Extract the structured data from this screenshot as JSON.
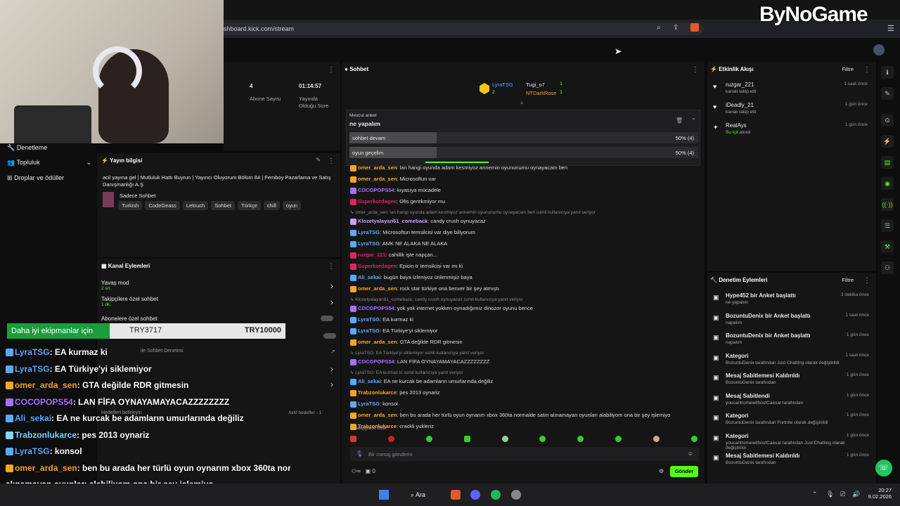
{
  "browser": {
    "url": "shboard.kick.com/stream"
  },
  "watermark": "ByNoGame",
  "left_nav": [
    {
      "label": "Denetleme"
    },
    {
      "label": "Topluluk"
    },
    {
      "label": "Droplar ve ödüller"
    }
  ],
  "stats": {
    "subs_value": "4",
    "subs_label": "Abone Sayısı",
    "time_value": "01:14:57",
    "time_label1": "Yayında",
    "time_label2": "Olduğu Süre"
  },
  "stream_info": {
    "header": "Yayın bilgisi",
    "title": "acil yayına gel | Mutluluk Hattı Buyrun | Yayıncı Oluyorum Bölüm 84 | Femboy Pazarlama ve Satış Danışmanlığı A.Ş",
    "category": "Sadece Sohbet",
    "tags": [
      "Turkish",
      "CodeGeass",
      "Lelouch",
      "Sohbet",
      "Türkçe",
      "chill",
      "oyun"
    ]
  },
  "channel_actions": {
    "header": "Kanal Eylemleri",
    "items": [
      {
        "label": "Yavaş mod",
        "sub": "2 sn."
      },
      {
        "label": "Takipçilere özel sohbet",
        "sub": "1 dk."
      },
      {
        "label": "Abonelere özel sohbet",
        "sub": ""
      }
    ],
    "extra1": "ile Sohbet Denetimi",
    "extra2": "Hedefleri belirleyin",
    "extra3": "Aktif hedefler - 1"
  },
  "chat": {
    "header": "Sohbet",
    "top_users": [
      {
        "name": "LyraTSG",
        "count": "2"
      },
      {
        "name": "Tugi_o7",
        "count": "1"
      },
      {
        "name": "NTDarkRose",
        "count": "1"
      }
    ],
    "poll": {
      "label": "Mevcut anket",
      "question": "ne yapalım",
      "options": [
        {
          "text": "sohbet devam",
          "pct": "50% (4)",
          "fill": 0.5
        },
        {
          "text": "oyun geçelim",
          "pct": "50% (4)",
          "fill": 0.5
        }
      ]
    },
    "lines": [
      {
        "user": "omer_arda_sen",
        "color": "#f5a623",
        "text": ": lan hangi oyunda adam kesmiyoz annemin oyununumu oynayacam ben"
      },
      {
        "user": "omer_arda_sen",
        "color": "#f5a623",
        "text": ": Microsoftun var"
      },
      {
        "user": "COCOPOPS54",
        "color": "#a970ff",
        "text": ": kıyasıya mücadele"
      },
      {
        "user": "Superkordagen",
        "color": "#e0245e",
        "text": ": Ofis gerekmiyor mu"
      },
      {
        "sys": "omer_arda_sen: lan hangi oyunda adam kesmiyoz annemin oyununumu oynayacam ben isimli kullanıcıya yanıt veriyor"
      },
      {
        "user": "Klozetyalayan61_comeback",
        "color": "#c9a0ff",
        "text": ": candy crush oynuyacaz"
      },
      {
        "user": "LyraTSG",
        "color": "#5aa9ff",
        "text": ": Microsoftun temsilcisi var diye biliyorum"
      },
      {
        "user": "LyraTSG",
        "color": "#5aa9ff",
        "text": ": AMK NE ALAKA NE ALAKA"
      },
      {
        "user": "ruzgar_221",
        "color": "#e0245e",
        "text": ": cahillik işte napçan..."
      },
      {
        "user": "Superkordagen",
        "color": "#e0245e",
        "text": ": Epicin tr temsilcisi var mı ki"
      },
      {
        "user": "Ali_sekai",
        "color": "#5aa9ff",
        "text": ": bugün baya izleniyoz ünlenmişiz baya"
      },
      {
        "user": "omer_arda_sen",
        "color": "#f5a623",
        "text": ": rock star türkiye ona benxer bir şey atmıştı"
      },
      {
        "sys": "Klozetyalayan61_comeback: candy crush oynuyacaz isimli kullanıcıya yanıt veriyor"
      },
      {
        "user": "COCOPOPS54",
        "color": "#a970ff",
        "text": ": yok yok internet yokken oynadığımız dinozor oyunu bence"
      },
      {
        "user": "LyraTSG",
        "color": "#5aa9ff",
        "text": ": EA kurmaz ki"
      },
      {
        "user": "LyraTSG",
        "color": "#5aa9ff",
        "text": ": EA Türkiye'yi siklemiyor"
      },
      {
        "user": "omer_arda_sen",
        "color": "#f5a623",
        "text": ": GTA değilde RDR gitmesin"
      },
      {
        "sys": "LyraTSG: EA Türkiye'yi siklemiyor isimli kullanıcıya yanıt veriyor"
      },
      {
        "user": "COCOPOPS54",
        "color": "#a970ff",
        "text": ": LAN FİFA OYNAYAMAYACAZZZZZZZZ"
      },
      {
        "sys": "LyraTSG: EA kurmaz ki isimli kullanıcıya yanıt veriyor"
      },
      {
        "user": "Ali_sekai",
        "color": "#5aa9ff",
        "text": ": EA ne kurcak be adamların umurlarında değiliz"
      },
      {
        "user": "Trabzonlukarce",
        "color": "#f5a623",
        "text": ": pes 2013 oynariz"
      },
      {
        "user": "LyraTSG",
        "color": "#5aa9ff",
        "text": ": konsol"
      },
      {
        "user": "omer_arda_sen",
        "color": "#f5a623",
        "text": ": ben bu arada her türlü oyun oynarım xbox 360ta normalde satın alınamayan oyunları alabiliyom ona bir şey işlemiyo"
      },
      {
        "user": "Trabzonlukarce",
        "color": "#f5a623",
        "text": ": crackli yukleriz"
      }
    ],
    "followers_only": "Takipçilere Özel",
    "input_placeholder": "Bir mesaj gönderin",
    "infinity": "∞",
    "zero": "0",
    "send": "Gönder"
  },
  "activity": {
    "header": "Etkinlik Akışı",
    "filter": "Filtre",
    "items": [
      {
        "name": "ruzgar_221",
        "sub": "kanalı takip etti",
        "time": "1 saat önce"
      },
      {
        "name": "iDeadly_21",
        "sub": "kanalı takip etti",
        "time": "1 gün önce"
      },
      {
        "name": "RealAys",
        "sub": "Su içir",
        "sub2": " alındı",
        "time": "1 gün önce"
      }
    ]
  },
  "moderation": {
    "header": "Denetim Eylemleri",
    "filter": "Filtre",
    "items": [
      {
        "title": "Hype452 bir Anket başlattı",
        "sub": "ne yapalım",
        "time": "3 dakika önce"
      },
      {
        "title": "BozuntuDenix bir Anket başlattı",
        "sub": "napalım",
        "time": "1 saat önce"
      },
      {
        "title": "BozuntuDenix bir Anket başlattı",
        "sub": "napalım",
        "time": "1 gün önce"
      },
      {
        "title": "Kategori",
        "sub": "BozuntuDenix tarafından Just Chatting olarak değiştirildi",
        "time": "1 saat önce"
      },
      {
        "title": "Mesaj Sabitlemesi Kaldırıldı",
        "sub": "BozuntuDenix tarafından",
        "time": "1 gün önce"
      },
      {
        "title": "Mesaj Sabitlendi",
        "sub": "youcantromewithoutCaesar tarafından",
        "time": "1 gün önce"
      },
      {
        "title": "Kategori",
        "sub": "BozuntuDenix tarafından Fortnite olarak değiştirildi",
        "time": "1 gün önce"
      },
      {
        "title": "Kategori",
        "sub": "youcantromewithoutCaesar tarafından Just Chatting olarak değiştirildi",
        "time": "1 gün önce"
      },
      {
        "title": "Mesaj Sabitlemesi Kaldırıldı",
        "sub": "BozuntuDenix tarafından",
        "time": "1 gün önce"
      }
    ]
  },
  "overlay": {
    "banner_text": "Daha iyi ekipmanlar için",
    "banner_amount": "TRY3717",
    "banner_goal": "TRY10000",
    "lines": [
      {
        "user": "LyraTSG",
        "color": "#5aa9ff",
        "text": ": EA kurmaz ki"
      },
      {
        "user": "LyraTSG",
        "color": "#5aa9ff",
        "text": ": EA Türkiye'yi siklemiyor"
      },
      {
        "user": "omer_arda_sen",
        "color": "#f5a623",
        "text": ": GTA değilde RDR gitmesin"
      },
      {
        "user": "COCOPOPS54",
        "color": "#a970ff",
        "text": ": LAN FİFA OYNAYAMAYACAZZZZZZZZ"
      },
      {
        "user": "Ali_sekai",
        "color": "#5aa9ff",
        "text": ": EA ne kurcak be adamların umurlarında değiliz"
      },
      {
        "user": "Trabzonlukarce",
        "color": "#7fd7ff",
        "text": ": pes 2013 oynariz"
      },
      {
        "user": "LyraTSG",
        "color": "#5aa9ff",
        "text": ": konsol"
      },
      {
        "user": "omer_arda_sen",
        "color": "#f5a623",
        "text": ": ben bu arada her türlü oyun oynarım xbox 360ta nor"
      },
      {
        "user": "",
        "color": "#fff",
        "text": "alınamayan oyunları alabiliyom ona bir şey işlemiyo"
      }
    ]
  },
  "taskbar": {
    "search": "Ara",
    "time": "20:27",
    "date": "9.02.2026"
  }
}
